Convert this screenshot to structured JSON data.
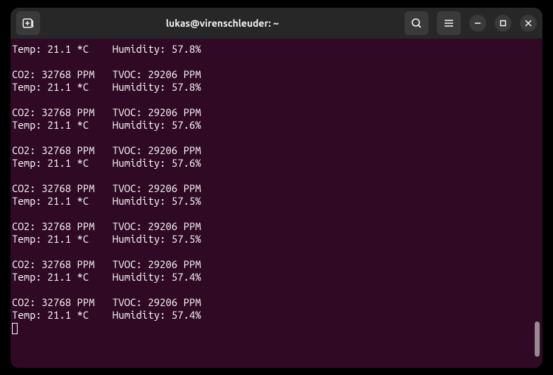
{
  "window": {
    "title": "lukas@virenschleuder: ~"
  },
  "icons": {
    "new_tab": "new-tab",
    "search": "search",
    "menu": "menu",
    "minimize": "minimize",
    "maximize": "maximize",
    "close": "close"
  },
  "terminal": {
    "lines": [
      "Temp: 21.1 *C    Humidity: 57.8%",
      "",
      "CO2: 32768 PPM   TVOC: 29206 PPM",
      "Temp: 21.1 *C    Humidity: 57.8%",
      "",
      "CO2: 32768 PPM   TVOC: 29206 PPM",
      "Temp: 21.1 *C    Humidity: 57.6%",
      "",
      "CO2: 32768 PPM   TVOC: 29206 PPM",
      "Temp: 21.1 *C    Humidity: 57.6%",
      "",
      "CO2: 32768 PPM   TVOC: 29206 PPM",
      "Temp: 21.1 *C    Humidity: 57.5%",
      "",
      "CO2: 32768 PPM   TVOC: 29206 PPM",
      "Temp: 21.1 *C    Humidity: 57.5%",
      "",
      "CO2: 32768 PPM   TVOC: 29206 PPM",
      "Temp: 21.1 *C    Humidity: 57.4%",
      "",
      "CO2: 32768 PPM   TVOC: 29206 PPM",
      "Temp: 21.1 *C    Humidity: 57.4%",
      ""
    ]
  }
}
